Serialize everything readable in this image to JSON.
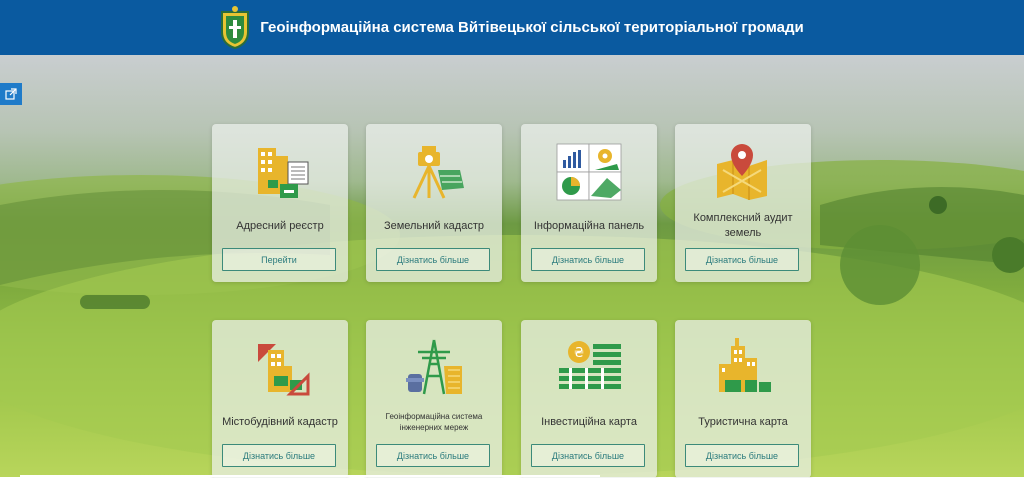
{
  "header": {
    "title": "Геоінформаційна система Вйтівецької сільської територіальної громади"
  },
  "cards": [
    {
      "label": "Адресний реєстр",
      "button": "Перейти"
    },
    {
      "label": "Земельний кадастр",
      "button": "Дізнатись більше"
    },
    {
      "label": "Інформаційна панель",
      "button": "Дізнатись більше"
    },
    {
      "label": "Комплексний аудит земель",
      "button": "Дізнатись більше"
    },
    {
      "label": "Містобудівний кадастр",
      "button": "Дізнатись більше"
    },
    {
      "label": "Геоінформаційна система інженерних мереж",
      "button": "Дізнатись більше"
    },
    {
      "label": "Інвестиційна карта",
      "button": "Дізнатись більше"
    },
    {
      "label": "Туристична карта",
      "button": "Дізнатись більше"
    }
  ],
  "colors": {
    "header": "#0a5aa0",
    "accent": "#1f7bc9",
    "button_text": "#2b7b7d",
    "green": "#2f9a4a",
    "yellow": "#e8b52c",
    "red": "#c94a3c"
  }
}
